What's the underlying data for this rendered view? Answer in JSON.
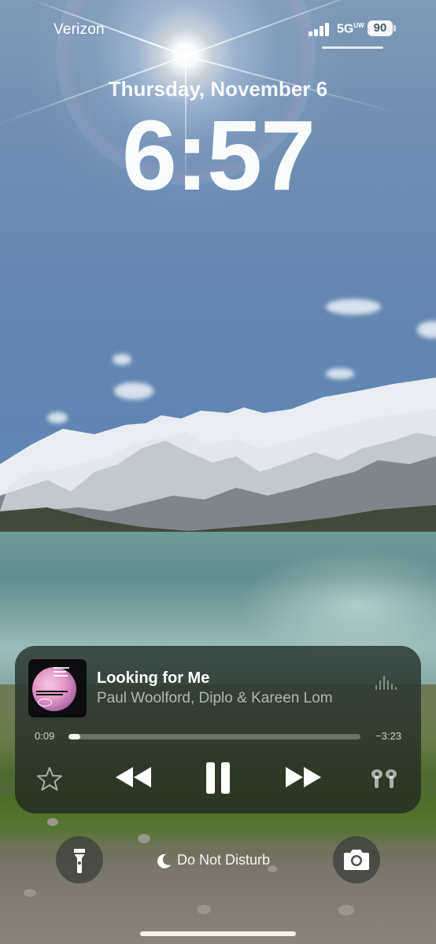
{
  "status_bar": {
    "carrier": "Verizon",
    "network": "5G",
    "network_suffix": "UW",
    "battery": "90"
  },
  "lock_screen": {
    "date": "Thursday, November 6",
    "time": "6:57"
  },
  "now_playing": {
    "title": "Looking for Me",
    "artist": "Paul Woolford, Diplo & Kareen Lom",
    "elapsed": "0:09",
    "remaining": "−3:23",
    "progress_fraction": 0.04,
    "icons": [
      "star-icon",
      "rewind-icon",
      "pause-icon",
      "fast-forward-icon",
      "airpods-icon",
      "waveform-icon"
    ]
  },
  "bottom": {
    "focus_label": "Do Not Disturb",
    "icons": [
      "flashlight-icon",
      "moon-icon",
      "camera-icon"
    ]
  }
}
